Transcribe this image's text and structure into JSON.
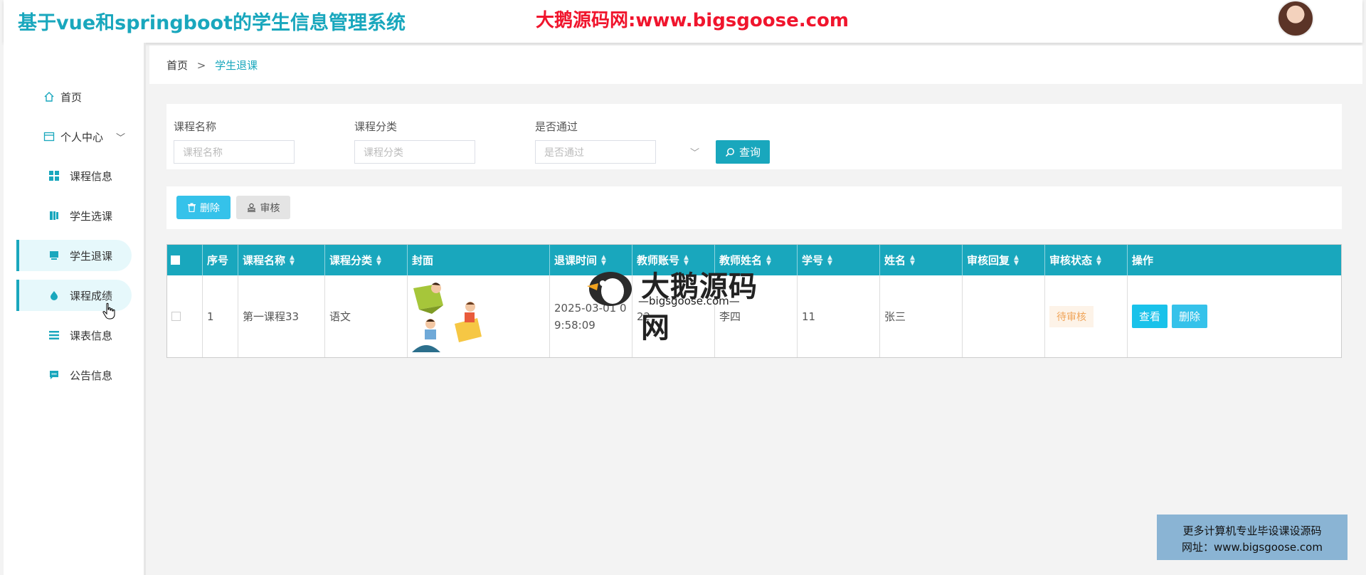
{
  "header": {
    "app_title": "基于vue和springboot的学生信息管理系统",
    "watermark_title": "大鹅源码网:www.bigsgoose.com"
  },
  "sidebar": {
    "items": [
      {
        "label": "首页",
        "icon": "home-icon"
      },
      {
        "label": "个人中心",
        "icon": "profile-card-icon",
        "expandable": true
      },
      {
        "label": "课程信息",
        "icon": "grid-icon"
      },
      {
        "label": "学生选课",
        "icon": "book-icon"
      },
      {
        "label": "学生退课",
        "icon": "flag-icon",
        "active": true
      },
      {
        "label": "课程成绩",
        "icon": "drop-icon",
        "hover": true
      },
      {
        "label": "课表信息",
        "icon": "list-icon"
      },
      {
        "label": "公告信息",
        "icon": "chat-icon"
      }
    ]
  },
  "breadcrumb": {
    "home": "首页",
    "separator": ">",
    "current": "学生退课"
  },
  "search": {
    "course_name_label": "课程名称",
    "course_name_placeholder": "课程名称",
    "course_category_label": "课程分类",
    "course_category_placeholder": "课程分类",
    "passed_label": "是否通过",
    "passed_placeholder": "是否通过",
    "query_button": "查询"
  },
  "actions": {
    "delete_button": "删除",
    "audit_button": "审核"
  },
  "table": {
    "columns": [
      "序号",
      "课程名称",
      "课程分类",
      "封面",
      "退课时间",
      "教师账号",
      "教师姓名",
      "学号",
      "姓名",
      "审核回复",
      "审核状态",
      "操作"
    ],
    "rows": [
      {
        "index": "1",
        "course_name": "第一课程33",
        "course_category": "语文",
        "cover": "cover-image",
        "drop_time_line1": "2025-03-01 0",
        "drop_time_line2": "9:58:09",
        "teacher_account": "22",
        "teacher_name": "李四",
        "student_no": "11",
        "student_name": "张三",
        "audit_reply": "",
        "audit_status": "待审核",
        "view_button": "查看",
        "delete_button": "删除"
      }
    ]
  },
  "overlay_watermark": {
    "title": "大鹅源码网",
    "subtitle": "—bigsgoose.com—"
  },
  "ad_box": {
    "line1": "更多计算机专业毕设课设源码",
    "line2": "网址：www.bigsgoose.com"
  },
  "colors": {
    "accent": "#19a7bd",
    "watermark_red": "#f0152d",
    "button_blue": "#35c2ea",
    "status_orange": "#f0a55a"
  }
}
